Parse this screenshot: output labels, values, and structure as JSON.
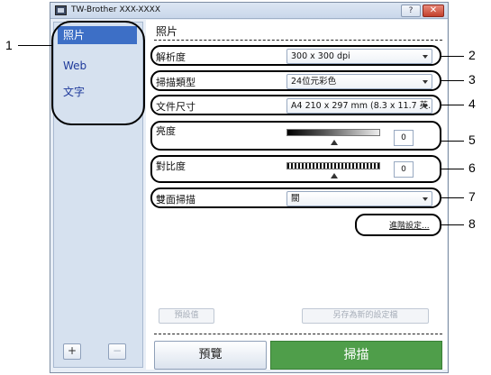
{
  "window": {
    "title": "TW-Brother  XXX-XXXX",
    "help_label": "?",
    "close_label": "✕"
  },
  "sidebar": {
    "items": [
      {
        "label": "照片",
        "active": true
      },
      {
        "label": "Web",
        "active": false
      },
      {
        "label": "文字",
        "active": false
      }
    ],
    "add_label": "+",
    "remove_label": "−"
  },
  "main": {
    "section_title": "照片",
    "resolution": {
      "label": "解析度",
      "value": "300 x 300 dpi"
    },
    "scan_type": {
      "label": "掃描類型",
      "value": "24位元彩色"
    },
    "document_size": {
      "label": "文件尺寸",
      "value": "A4 210 x 297 mm (8.3 x 11.7 英..."
    },
    "brightness": {
      "label": "亮度",
      "value": "0"
    },
    "contrast": {
      "label": "對比度",
      "value": "0"
    },
    "duplex": {
      "label": "雙面掃描",
      "value": "關"
    },
    "advanced_link": "進階設定...",
    "default_button": "預設值",
    "save_as_new_button": "另存為新的設定檔",
    "preview_button": "預覽",
    "scan_button": "掃描"
  },
  "callouts": [
    "1",
    "2",
    "3",
    "4",
    "5",
    "6",
    "7",
    "8"
  ],
  "colors": {
    "accent": "#3d6fc6",
    "scan_button": "#4f9e4a",
    "close_button": "#c2402c"
  }
}
